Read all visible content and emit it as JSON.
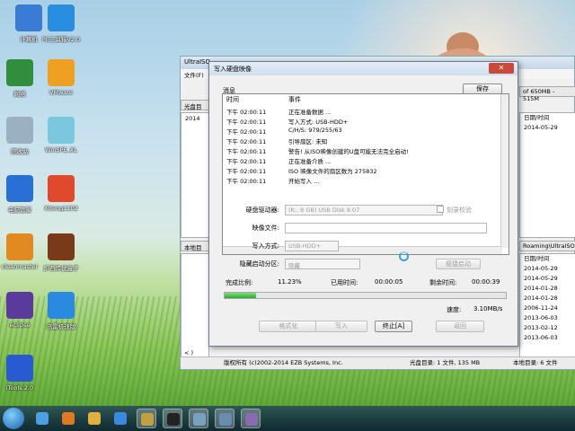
{
  "desktop": {
    "icons": [
      {
        "label": "计算机",
        "icon": "computer-icon",
        "color": "#3a7bd5"
      },
      {
        "label": "PE工具箱V2.0",
        "icon": "pe-toolbox-icon",
        "color": "#2a8ee0"
      },
      {
        "label": "网络",
        "icon": "network-globe-icon",
        "color": "#2f8f3f"
      },
      {
        "label": "VMware",
        "icon": "vmware-icon",
        "color": "#f0a020"
      },
      {
        "label": "回收站",
        "icon": "recycle-bin-icon",
        "color": "#9bb0c0"
      },
      {
        "label": "WinSPE_XL",
        "icon": "cd-disc-icon",
        "color": "#7ac8e0"
      },
      {
        "label": "电脑管家",
        "icon": "tencent-pc-manager-icon",
        "color": "#2a6fd6"
      },
      {
        "label": "Xiteng1102",
        "icon": "windows-logo-icon",
        "color": "#e04a2a"
      },
      {
        "label": "cleanmaster",
        "icon": "broom-icon",
        "color": "#e08a20"
      },
      {
        "label": "炉石传说盒子",
        "icon": "hearthstone-icon",
        "color": "#7a3a1a"
      },
      {
        "label": "eclipse",
        "icon": "eclipse-icon",
        "color": "#5a3a9a"
      },
      {
        "label": "迅雷极速版",
        "icon": "thunder-bird-icon",
        "color": "#2a8ae0"
      },
      {
        "label": "iTools 2.0",
        "icon": "itools-icon",
        "color": "#2a5ad0"
      }
    ]
  },
  "ultraiso": {
    "title": "UltraISO",
    "menu_file": "文件(F)",
    "tab_cd": "光盘目",
    "cd_item": "2014",
    "size_info": "of 650MB - 515M",
    "local_tab": "本地目",
    "path": "Roaming\\UltraISO",
    "col_date": "日期/时间",
    "dates_top": [
      "2014-05-29"
    ],
    "dates_bottom": [
      "2014-05-29",
      "2014-05-29",
      "2014-01-28",
      "2014-01-28",
      "2006-11-24",
      "2013-06-03",
      "2013-02-12",
      "2013-06-03"
    ],
    "status_copyright": "版权所有 (c)2002-2014 EZB Systems, Inc.",
    "status_cd": "光盘目录: 1 文件, 135 MB",
    "status_local": "本地目录: 6 文件",
    "left_frag": "< )"
  },
  "dialog": {
    "title": "写入硬盘映像",
    "close": "✕",
    "msg_label": "消息",
    "save_button": "保存",
    "col_time": "时间",
    "col_event": "事件",
    "log": [
      {
        "time": "下午 02:00:11",
        "event": "正在准备数据 ..."
      },
      {
        "time": "下午 02:00:11",
        "event": "写入方式: USB-HDD+"
      },
      {
        "time": "下午 02:00:11",
        "event": "C/H/S: 979/255/63"
      },
      {
        "time": "下午 02:00:11",
        "event": "引导扇区: 未知"
      },
      {
        "time": "下午 02:00:11",
        "event": "警告! 从ISO映像创建的U盘可能无法完全启动!"
      },
      {
        "time": "下午 02:00:11",
        "event": "正在准备介质 ..."
      },
      {
        "time": "下午 02:00:11",
        "event": "ISO 映像文件的扇区数为 275832"
      },
      {
        "time": "下午 02:00:11",
        "event": "开始写入 ..."
      }
    ],
    "drive_label": "硬盘驱动器:",
    "drive_value": "(K:, 8 GB)          USB Disk        8.07",
    "verify_label": "刻录校验",
    "image_label": "映像文件:",
    "image_value": "",
    "write_mode_label": "写入方式:",
    "write_mode_value": "USB-HDD+",
    "hide_label": "隐藏启动分区:",
    "hide_value": "隐藏",
    "quick_boot_button": "便捷启动",
    "complete_label": "完成比例:",
    "complete_value": "11.23%",
    "elapsed_label": "已用时间:",
    "elapsed_value": "00:00:05",
    "remaining_label": "剩余时间:",
    "remaining_value": "00:00:39",
    "progress_fraction": 0.1123,
    "speed_label": "速度:",
    "speed_value": "3.10MB/s",
    "format_button": "格式化",
    "write_button": "写入",
    "terminate_button": "终止[A]",
    "back_button": "返回"
  },
  "taskbar": {
    "items": [
      {
        "icon": "start-orb-icon",
        "color": "#3a8ad8"
      },
      {
        "icon": "network-icon",
        "color": "#4aa0e0"
      },
      {
        "icon": "firefox-icon",
        "color": "#e07a20"
      },
      {
        "icon": "folder-icon",
        "color": "#e0b040"
      },
      {
        "icon": "pe-tool-icon",
        "color": "#3a8ae0"
      },
      {
        "icon": "ultraiso-icon",
        "color": "#c0a040"
      },
      {
        "icon": "qq-icon",
        "color": "#222222"
      },
      {
        "icon": "clean-icon",
        "color": "#7aa0c0"
      },
      {
        "icon": "window-icon",
        "color": "#6a8ab0"
      },
      {
        "icon": "disc-icon",
        "color": "#8a6ab0"
      }
    ]
  }
}
